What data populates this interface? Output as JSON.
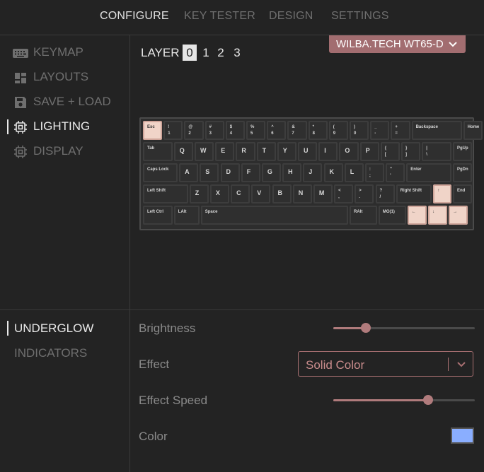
{
  "nav": {
    "tabs": [
      {
        "label": "CONFIGURE",
        "active": true
      },
      {
        "label": "KEY TESTER",
        "active": false
      },
      {
        "label": "DESIGN",
        "active": false
      },
      {
        "label": "SETTINGS",
        "active": false
      }
    ]
  },
  "sidebar": {
    "items": [
      {
        "label": "KEYMAP",
        "icon": "keyboard-icon",
        "active": false
      },
      {
        "label": "LAYOUTS",
        "icon": "layout-grid-icon",
        "active": false
      },
      {
        "label": "SAVE + LOAD",
        "icon": "floppy-disk-icon",
        "active": false
      },
      {
        "label": "LIGHTING",
        "icon": "chip-icon",
        "active": true
      },
      {
        "label": "DISPLAY",
        "icon": "chip-icon",
        "active": false
      }
    ]
  },
  "layer": {
    "label": "LAYER",
    "options": [
      "0",
      "1",
      "2",
      "3"
    ],
    "selected": "0"
  },
  "device": {
    "label": "WILBA.TECH WT65-D"
  },
  "keyboard": {
    "rows": [
      [
        "Esc",
        "!\n1",
        "@\n2",
        "#\n3",
        "$\n4",
        "%\n5",
        "^\n6",
        "&\n7",
        "*\n8",
        "(\n9",
        ")\n0",
        "_\n-",
        "+\n=",
        "Backspace",
        "Home"
      ],
      [
        "Tab",
        "Q",
        "W",
        "E",
        "R",
        "T",
        "Y",
        "U",
        "I",
        "O",
        "P",
        "{\n[",
        "}\n]",
        "|\n\\",
        "PgUp"
      ],
      [
        "Caps Lock",
        "A",
        "S",
        "D",
        "F",
        "G",
        "H",
        "J",
        "K",
        "L",
        ":\n;",
        "\"\n'",
        "Enter",
        "PgDn"
      ],
      [
        "Left Shift",
        "Z",
        "X",
        "C",
        "V",
        "B",
        "N",
        "M",
        "<\n,",
        ">\n.",
        "?\n/",
        "Right Shift",
        "↑",
        "End"
      ],
      [
        "Left Ctrl",
        "LAlt",
        "Space",
        "RAlt",
        "MO(1)",
        "←",
        "↓",
        "→"
      ]
    ],
    "highlighted": [
      "Esc",
      "↑",
      "←",
      "↓",
      "→"
    ]
  },
  "lighting": {
    "sections": [
      {
        "label": "UNDERGLOW",
        "active": true
      },
      {
        "label": "INDICATORS",
        "active": false
      }
    ],
    "brightness": {
      "label": "Brightness",
      "value": 0.23
    },
    "effect": {
      "label": "Effect",
      "value": "Solid Color"
    },
    "effect_speed": {
      "label": "Effect Speed",
      "value": 0.67
    },
    "color": {
      "label": "Color",
      "value": "#8aaeff"
    }
  },
  "colors": {
    "accent": "#b07b7c",
    "background": "#232323"
  }
}
